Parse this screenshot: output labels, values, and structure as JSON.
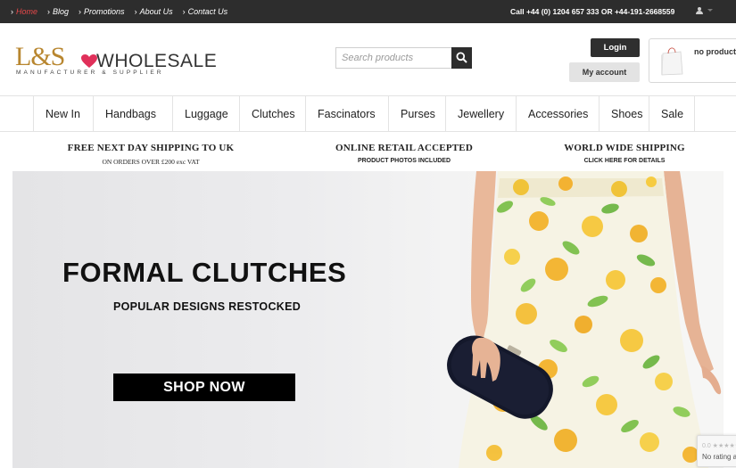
{
  "topbar": {
    "nav": [
      {
        "label": "Home",
        "active": true
      },
      {
        "label": "Blog",
        "active": false
      },
      {
        "label": "Promotions",
        "active": false
      },
      {
        "label": "About Us",
        "active": false
      },
      {
        "label": "Contact Us",
        "active": false
      }
    ],
    "phone": "Call +44 (0) 1204 657 333 OR +44-191-2668559",
    "user_icon": "user-icon"
  },
  "header": {
    "logo": {
      "monogram": "L&S",
      "word": "WHOLESALE",
      "tagline": "MANUFACTURER & SUPPLIER"
    },
    "search": {
      "placeholder": "Search products",
      "icon": "search-icon"
    },
    "login_label": "Login",
    "account_label": "My account",
    "cart": {
      "text": "no products",
      "icon": "shopping-bag-icon"
    }
  },
  "categories": [
    "New In",
    "Handbags",
    "Luggage",
    "Clutches",
    "Fascinators",
    "Purses",
    "Jewellery",
    "Accessories",
    "Shoes",
    "Sale"
  ],
  "info": [
    {
      "title": "FREE NEXT DAY SHIPPING TO UK",
      "sub": "ON ORDERS OVER £200 exc VAT"
    },
    {
      "title": "ONLINE RETAIL ACCEPTED",
      "sub": "PRODUCT PHOTOS INCLUDED"
    },
    {
      "title": "WORLD WIDE SHIPPING",
      "sub": "CLICK HERE FOR DETAILS"
    }
  ],
  "hero": {
    "title": "FORMAL CLUTCHES",
    "subtitle": "POPULAR DESIGNS RESTOCKED",
    "cta": "SHOP NOW"
  },
  "rating": {
    "stars": "0.0 ★★★★★",
    "text": "No rating a"
  },
  "colors": {
    "topbar": "#2d2d2d",
    "active_link": "#e8484a",
    "brand_gold": "#b8862f",
    "heart": "#e0305a",
    "button_dark": "#000000"
  }
}
